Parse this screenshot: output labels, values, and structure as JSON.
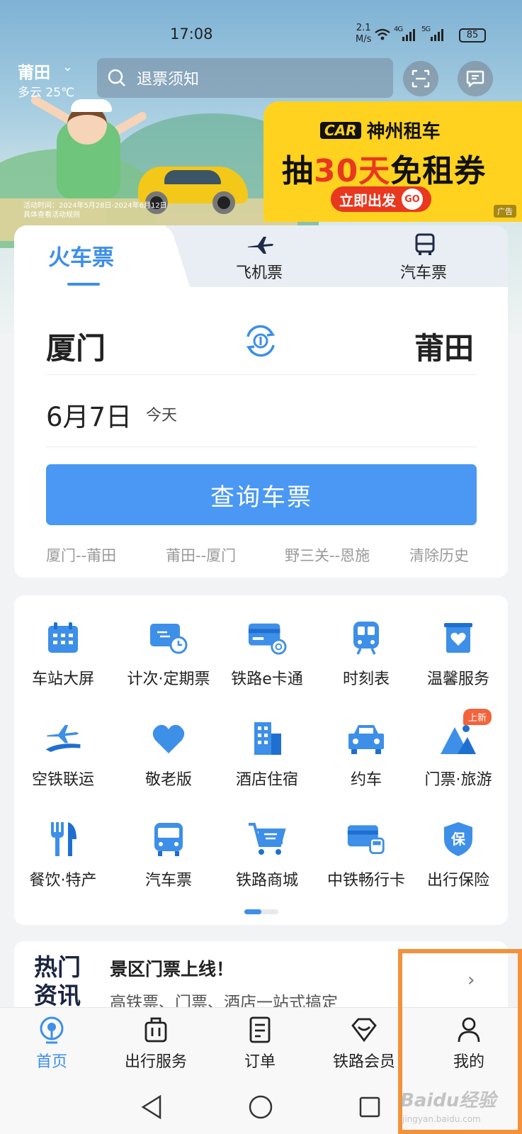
{
  "status_bar": {
    "time": "17:08",
    "speed_value": "2.1",
    "speed_unit": "M/s",
    "sig1": "4G",
    "sig2": "5G",
    "battery": "85"
  },
  "header": {
    "city": "莆田",
    "weather": "多云 25℃",
    "search_placeholder": "退票须知"
  },
  "banner": {
    "fine_print_line1": "活动时间：2024年5月28日-2024年6月12日",
    "fine_print_line2": "具体查看活动规则",
    "ad_logo": "CAR",
    "ad_brand": "神州租车",
    "ad_title_pre": "抽",
    "ad_title_num": "30天",
    "ad_title_post": "免租券",
    "ad_cta": "立即出发",
    "ad_cta_go": "GO",
    "ad_badge": "广告"
  },
  "tabs": {
    "train": "火车票",
    "flight": "飞机票",
    "bus": "汽车票"
  },
  "ticket": {
    "from": "厦门",
    "to": "莆田",
    "date": "6月7日",
    "date_note": "今天",
    "query_button": "查询车票",
    "history": [
      "厦门--莆田",
      "莆田--厦门",
      "野三关--恩施",
      "清除历史"
    ]
  },
  "services": [
    {
      "label": "车站大屏",
      "icon": "calendar-icon"
    },
    {
      "label": "计次·定期票",
      "icon": "ticket-clock-icon"
    },
    {
      "label": "铁路e卡通",
      "icon": "card-icon"
    },
    {
      "label": "时刻表",
      "icon": "train-icon"
    },
    {
      "label": "温馨服务",
      "icon": "heart-box-icon"
    },
    {
      "label": "空铁联运",
      "icon": "plane-train-icon"
    },
    {
      "label": "敬老版",
      "icon": "heart-icon"
    },
    {
      "label": "酒店住宿",
      "icon": "building-icon"
    },
    {
      "label": "约车",
      "icon": "car-icon"
    },
    {
      "label": "门票·旅游",
      "icon": "mountain-icon"
    },
    {
      "label": "餐饮·特产",
      "icon": "fork-knife-icon"
    },
    {
      "label": "汽车票",
      "icon": "bus-icon"
    },
    {
      "label": "铁路商城",
      "icon": "cart-icon"
    },
    {
      "label": "中铁畅行卡",
      "icon": "card-train-icon"
    },
    {
      "label": "出行保险",
      "icon": "shield-icon"
    }
  ],
  "new_badge": "上新",
  "news": {
    "tag_line1": "热门",
    "tag_line2": "资讯",
    "title": "景区门票上线！",
    "subtitle": "高铁票、门票、酒店一站式搞定"
  },
  "bottom_nav": [
    {
      "label": "首页",
      "icon": "home-rail-icon",
      "active": true
    },
    {
      "label": "出行服务",
      "icon": "luggage-icon",
      "active": false
    },
    {
      "label": "订单",
      "icon": "order-icon",
      "active": false
    },
    {
      "label": "铁路会员",
      "icon": "diamond-icon",
      "active": false
    },
    {
      "label": "我的",
      "icon": "person-icon",
      "active": false
    }
  ],
  "watermark": {
    "text": "Baidu经验",
    "sub": "jingyan.baidu.com"
  },
  "colors": {
    "accent": "#3d8fe8",
    "query_button": "#4a98f3",
    "ad_yellow": "#ffd21f",
    "ad_red": "#e8381f",
    "highlight": "#f2923c"
  }
}
